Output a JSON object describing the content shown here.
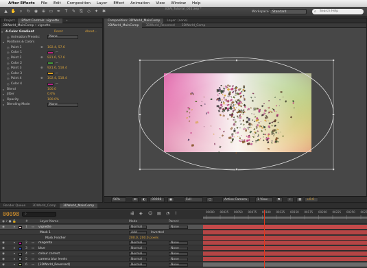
{
  "menubar": {
    "apple": "",
    "app": "After Effects",
    "items": [
      "File",
      "Edit",
      "Composition",
      "Layer",
      "Effect",
      "Animation",
      "View",
      "Window",
      "Help"
    ]
  },
  "toolbar": {
    "doc_title": "3DW_Tutorial_005.aep *",
    "workspace_label": "Workspace:",
    "workspace_value": "Standard",
    "search_placeholder": "Search Help"
  },
  "left_panel": {
    "tabs": [
      "Project",
      "Effect Controls: vignette",
      "»"
    ],
    "header": "3DWorld_MainComp • vignette",
    "rows": [
      {
        "indent": 2,
        "kind": "fx",
        "label": "4-Color Gradient",
        "reset": "Reset",
        "about": "About..."
      },
      {
        "indent": 10,
        "kind": "preset",
        "label": "Animation Presets:",
        "value": "None"
      },
      {
        "indent": 4,
        "kind": "group",
        "label": "Positions & Colors"
      },
      {
        "indent": 10,
        "kind": "point",
        "label": "Point 1",
        "value": "102.4, 57.6"
      },
      {
        "indent": 10,
        "kind": "color",
        "label": "Color 1",
        "color": "#c0247e"
      },
      {
        "indent": 10,
        "kind": "point",
        "label": "Point 2",
        "value": "921.6, 57.6"
      },
      {
        "indent": 10,
        "kind": "color",
        "label": "Color 2",
        "color": "#46a03c"
      },
      {
        "indent": 10,
        "kind": "point",
        "label": "Point 3",
        "value": "921.6, 518.4"
      },
      {
        "indent": 10,
        "kind": "color",
        "label": "Color 3",
        "color": "#e3a31e"
      },
      {
        "indent": 10,
        "kind": "point",
        "label": "Point 4",
        "value": "102.4, 518.4"
      },
      {
        "indent": 10,
        "kind": "color",
        "label": "Color 4",
        "color": "#b7208a"
      },
      {
        "indent": 4,
        "kind": "prop",
        "label": "Blend",
        "value": "100.0"
      },
      {
        "indent": 4,
        "kind": "prop",
        "label": "Jitter",
        "value": "0.0%"
      },
      {
        "indent": 4,
        "kind": "prop",
        "label": "Opacity",
        "value": "100.0%"
      },
      {
        "indent": 4,
        "kind": "dropdown",
        "label": "Blending Mode",
        "value": "None"
      }
    ]
  },
  "viewer": {
    "tabs": [
      "Composition: 3DWorld_MainComp",
      "Layer: (none)"
    ],
    "subtabs": [
      "3DWorld_MainComp",
      "3DWorld_Reversed",
      "3DWorld_Comp"
    ],
    "zoom": "50%",
    "timecode": "00098",
    "resolution": "Full",
    "camera": "Active Camera",
    "views": "1 View",
    "exposure": "+0.0",
    "colors": {
      "ring": "#dcdcdc",
      "bg": "#474747"
    }
  },
  "timeline": {
    "tabs": [
      "Render Queue",
      "3DWorld_Comp",
      "3DWorld_MainComp"
    ],
    "current_time": "00098",
    "search_placeholder": "",
    "column_headers": {
      "name": "Layer Name",
      "mode": "Mode",
      "parent": "Parent"
    },
    "ruler_ticks": [
      "00000",
      "00025",
      "00050",
      "00075",
      "00100",
      "00125",
      "00150",
      "00175",
      "00200",
      "00225",
      "00250",
      "0027"
    ],
    "rows": [
      {
        "num": "1",
        "name": "vignette",
        "mode": "Normal",
        "parent": "None",
        "color": "#d8b9b9",
        "bar": "#c44a4a",
        "selected": true
      },
      {
        "num": "",
        "name": "Mask 1",
        "mode": "Add",
        "parent": "",
        "extra": "Inverted",
        "color": "",
        "bar": "#b54545",
        "selected": false
      },
      {
        "num": "",
        "name": "Mask Feather",
        "mode": "",
        "parent": "",
        "extra": "200.0, 200.0 pixels",
        "color": "",
        "bar": "#b54545",
        "selected": false
      },
      {
        "num": "2",
        "name": "magenta",
        "mode": "Normal",
        "parent": "None",
        "color": "#c01a9c",
        "bar": "#b54545",
        "selected": false
      },
      {
        "num": "3",
        "name": "blue",
        "mode": "Normal",
        "parent": "None",
        "color": "#2c4fc8",
        "bar": "#b54545",
        "selected": false
      },
      {
        "num": "4",
        "name": "colour correct",
        "mode": "Normal",
        "parent": "None",
        "color": "#7a7a7a",
        "bar": "#b54545",
        "selected": false
      },
      {
        "num": "5",
        "name": "camera blur levels",
        "mode": "Normal",
        "parent": "None",
        "color": "#9aa0a8",
        "bar": "#b54545",
        "selected": false
      },
      {
        "num": "6",
        "name": "[3DWorld_Reversed]",
        "mode": "Normal",
        "parent": "None",
        "color": "#a5b67a",
        "bar": "#6b6b6b",
        "selected": false
      }
    ]
  }
}
